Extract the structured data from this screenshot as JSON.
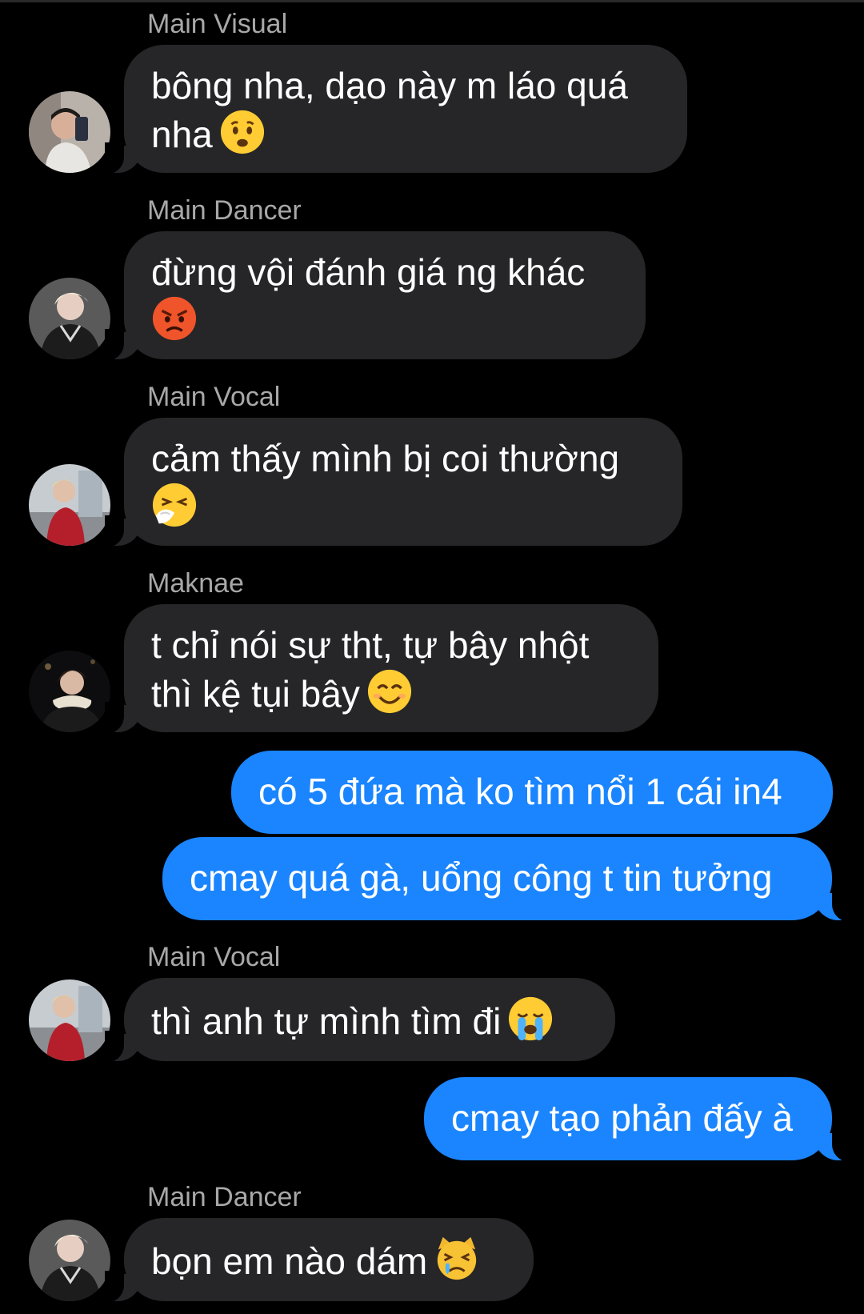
{
  "messages": [
    {
      "sender": "Main Visual",
      "text": "bông nha, dạo này m láo quá nha",
      "emoji": "worried-face-emoji"
    },
    {
      "sender": "Main Dancer",
      "text": "đừng vội đánh giá ng khác",
      "emoji": "angry-face-emoji"
    },
    {
      "sender": "Main Vocal",
      "text": "cảm thấy mình bị coi thường",
      "emoji": "sneezing-face-emoji"
    },
    {
      "sender": "Maknae",
      "text": "t chỉ nói sự tht, tự bây nhột thì kệ tụi bây",
      "emoji": "smiling-face-emoji"
    },
    {
      "sender": "me",
      "text": "có 5 đứa mà ko tìm nổi 1 cái in4"
    },
    {
      "sender": "me",
      "text": "cmay quá gà, uổng công t tin tưởng"
    },
    {
      "sender": "Main Vocal",
      "text": "thì anh tự mình tìm đi",
      "emoji": "loudly-crying-face-emoji"
    },
    {
      "sender": "me",
      "text": "cmay tạo phản đấy à"
    },
    {
      "sender": "Main Dancer",
      "text": "bọn em nào dám",
      "emoji": "crying-cat-face-emoji"
    }
  ],
  "colors": {
    "background": "#000000",
    "incoming_bubble": "#262628",
    "outgoing_bubble": "#1a85ff",
    "sender_name": "#a8a8a8"
  }
}
